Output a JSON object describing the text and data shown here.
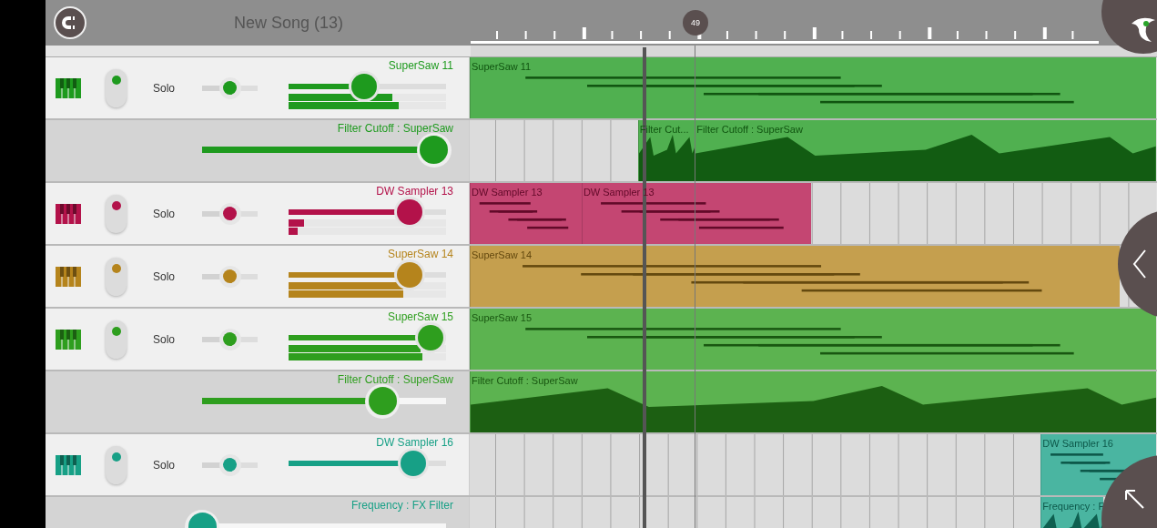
{
  "header": {
    "title": "New Song (13)"
  },
  "timeline": {
    "marker": "49"
  },
  "tracks": [
    {
      "kind": "instrument",
      "name": "SuperSaw 11",
      "color": "#1e9a1e",
      "enabled": true,
      "solo_label": "Solo",
      "pan": {
        "level": 0.5
      },
      "volume": {
        "level": 0.48
      },
      "meters": [
        {
          "level": 0.66
        },
        {
          "level": 0.7
        }
      ],
      "clips": [
        {
          "label": "SuperSaw 11"
        }
      ]
    },
    {
      "kind": "automation",
      "name": "Filter Cutoff : SuperSaw",
      "color": "#1e9a1e",
      "value": {
        "level": 0.95
      },
      "clips": [
        {
          "label": "Filter Cut..."
        },
        {
          "label": "Filter Cutoff : SuperSaw"
        }
      ]
    },
    {
      "kind": "instrument",
      "name": "DW Sampler 13",
      "color": "#b3124a",
      "enabled": true,
      "solo_label": "Solo",
      "pan": {
        "level": 0.5
      },
      "volume": {
        "level": 0.77
      },
      "meters": [
        {
          "level": 0.1
        },
        {
          "level": 0.06
        }
      ],
      "clips": [
        {
          "label": "DW Sampler 13"
        },
        {
          "label": "DW Sampler 13"
        }
      ]
    },
    {
      "kind": "instrument",
      "name": "SuperSaw 14",
      "color": "#b5841c",
      "enabled": true,
      "solo_label": "Solo",
      "pan": {
        "level": 0.5
      },
      "volume": {
        "level": 0.77
      },
      "meters": [
        {
          "level": 0.73
        },
        {
          "level": 0.73
        }
      ],
      "clips": [
        {
          "label": "SuperSaw 14"
        }
      ]
    },
    {
      "kind": "instrument",
      "name": "SuperSaw 15",
      "color": "#2e9e1e",
      "enabled": true,
      "solo_label": "Solo",
      "pan": {
        "level": 0.5
      },
      "volume": {
        "level": 0.9
      },
      "meters": [
        {
          "level": 0.84
        },
        {
          "level": 0.85
        }
      ],
      "clips": [
        {
          "label": "SuperSaw 15"
        }
      ]
    },
    {
      "kind": "automation",
      "name": "Filter Cutoff : SuperSaw",
      "color": "#2e9e1e",
      "value": {
        "level": 0.74
      },
      "clips": [
        {
          "label": "Filter Cutoff : SuperSaw"
        }
      ]
    },
    {
      "kind": "instrument",
      "name": "DW Sampler 16",
      "color": "#17a086",
      "enabled": true,
      "solo_label": "Solo",
      "pan": {
        "level": 0.5
      },
      "volume": {
        "level": 0.79
      },
      "clips": [
        {
          "label": "DW Sampler 16"
        }
      ]
    },
    {
      "kind": "automation",
      "name": "Frequency : FX Filter",
      "color": "#17a086",
      "value": {
        "level": 0
      },
      "clips": [
        {
          "label": "Frequency : F"
        }
      ]
    }
  ]
}
